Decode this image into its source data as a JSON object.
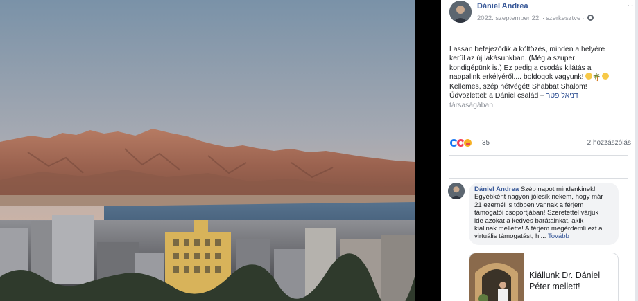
{
  "post": {
    "author": "Dániel Andrea",
    "date": "2022. szeptember 22.",
    "edited": "szerkesztve",
    "more_label": "···",
    "text_lines": [
      "Lassan befejeződik a költözés, minden a helyére",
      "kerül az új lakásunkban. (Még a szuper",
      "kondigépünk is.) Ez pedig a csodás kilátás a",
      "nappalink erkélyéről.... boldogok vagyunk!",
      "Kellemes, szép hétvégét! Shabbat Shalom!",
      "Üdvözlettel: a Dániel család"
    ],
    "tag_separator": " – ",
    "tag_name": "דניאל פטר",
    "tag_suffix": "társaságában.",
    "reaction_count": "35",
    "comment_count_label": "2 hozzászólás"
  },
  "comment": {
    "author": "Dániel Andrea",
    "first_line": " Szép napot mindenkinek!",
    "lines": [
      "Egyébként nagyon jólesik nekem, hogy már",
      "21 ezernél is többen vannak a férjem",
      "támogatói csoportjában! Szeretettel várjuk",
      "ide azokat a kedves barátainkat, akik",
      "kiállnak mellette! A férjem megérdemli ezt a"
    ],
    "last_line": "virtuális támogatást, hi...",
    "see_more": "Tovább",
    "link_card": {
      "title_lines": [
        "Kiállunk Dr. Dániel",
        "Péter mellett!"
      ]
    }
  },
  "icons": {
    "globe": "globe-icon",
    "like": "like-reaction-icon",
    "love": "love-reaction-icon",
    "care": "care-reaction-icon"
  },
  "colors": {
    "link_blue": "#385898",
    "muted_gray": "#90949c",
    "text": "#1c1e21",
    "bubble": "#f2f3f5"
  }
}
